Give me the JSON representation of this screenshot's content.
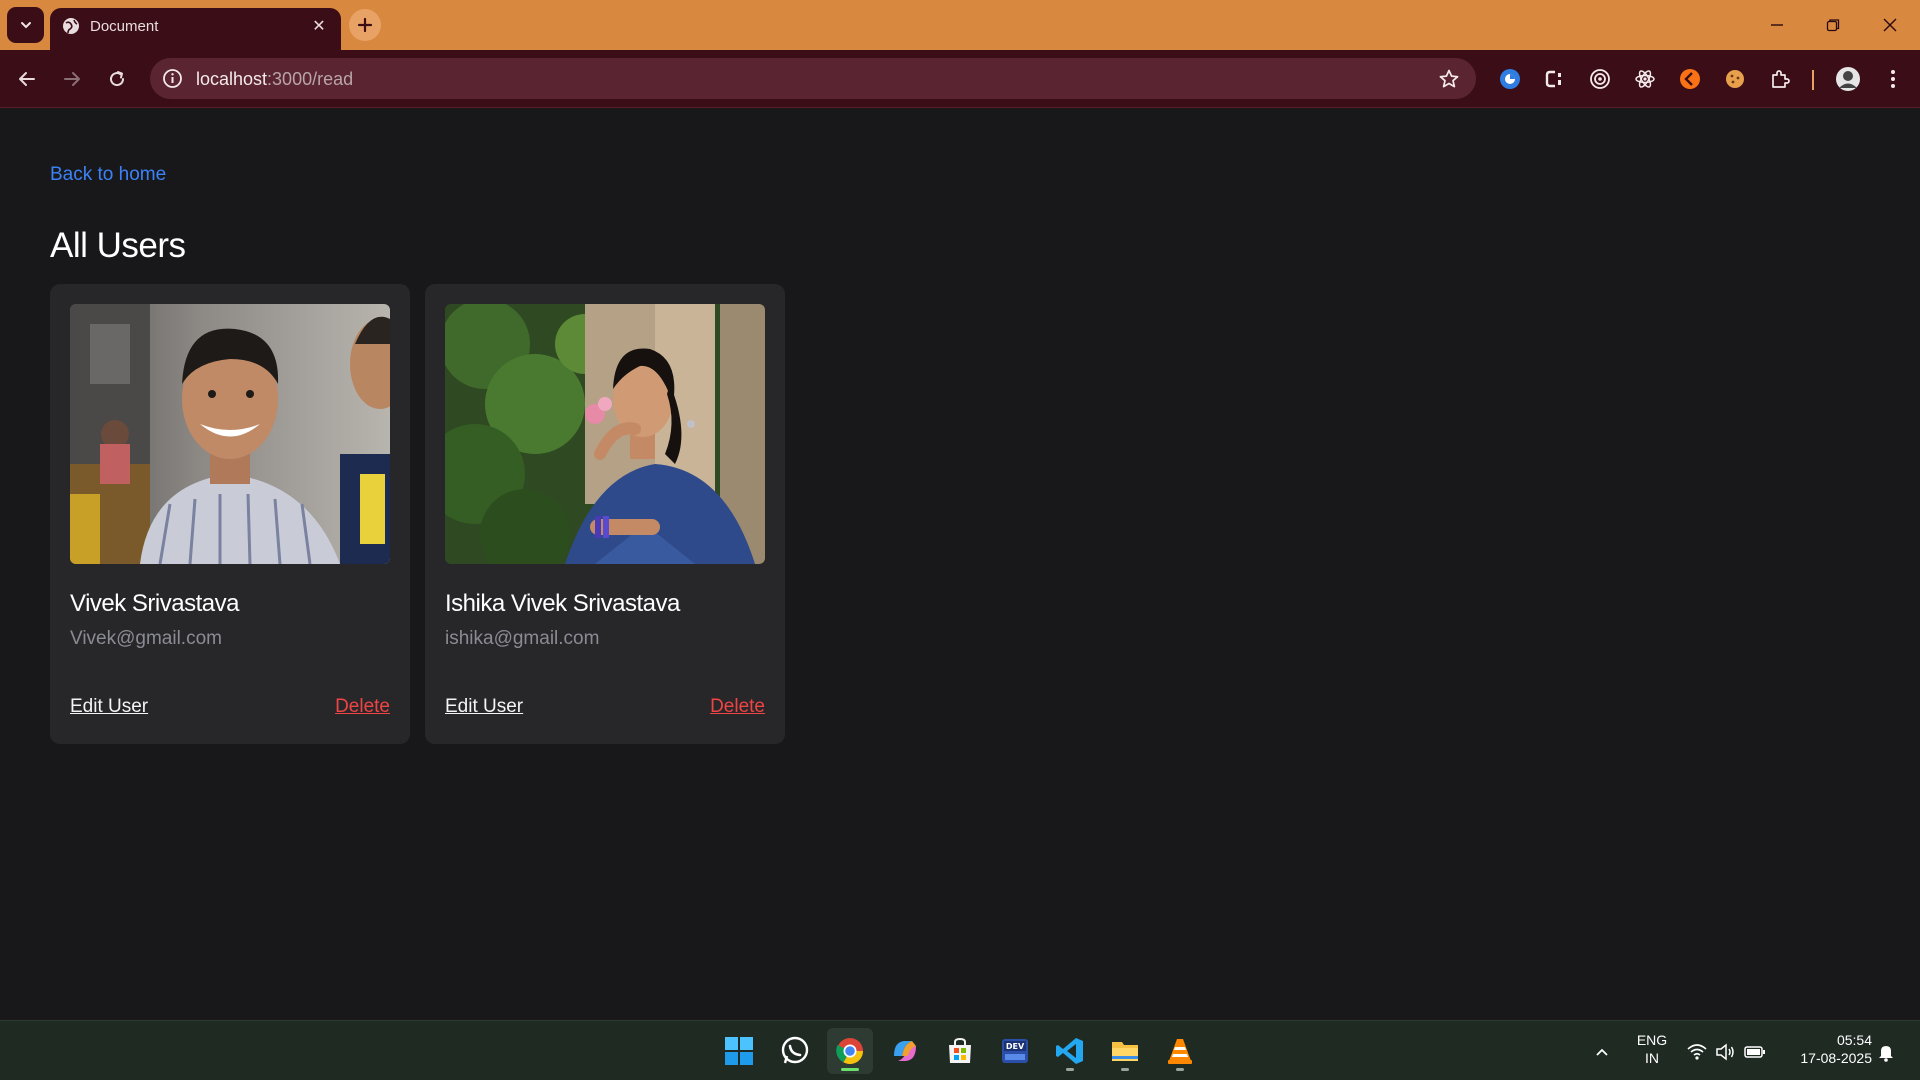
{
  "browser": {
    "tab_title": "Document",
    "url_host": "localhost",
    "url_path": ":3000/read",
    "theme_color": "#d9883f",
    "toolbar_color": "#3a0d17"
  },
  "page": {
    "back_link": "Back to home",
    "title": "All Users",
    "link_color": "#3b82f6",
    "delete_color": "#ef4444"
  },
  "users": [
    {
      "name": "Vivek Srivastava",
      "email": "Vivek@gmail.com",
      "edit_label": "Edit User",
      "delete_label": "Delete",
      "photo": "photo-man-smiling"
    },
    {
      "name": "Ishika Vivek Srivastava",
      "email": "ishika@gmail.com",
      "edit_label": "Edit User",
      "delete_label": "Delete",
      "photo": "photo-woman-in-garden"
    }
  ],
  "taskbar": {
    "language_top": "ENG",
    "language_bottom": "IN",
    "time": "05:54",
    "date": "17-08-2025",
    "apps": [
      "windows-start",
      "whatsapp",
      "chrome",
      "copilot",
      "microsoft-store",
      "dev-home",
      "vscode",
      "file-explorer",
      "vlc"
    ]
  }
}
